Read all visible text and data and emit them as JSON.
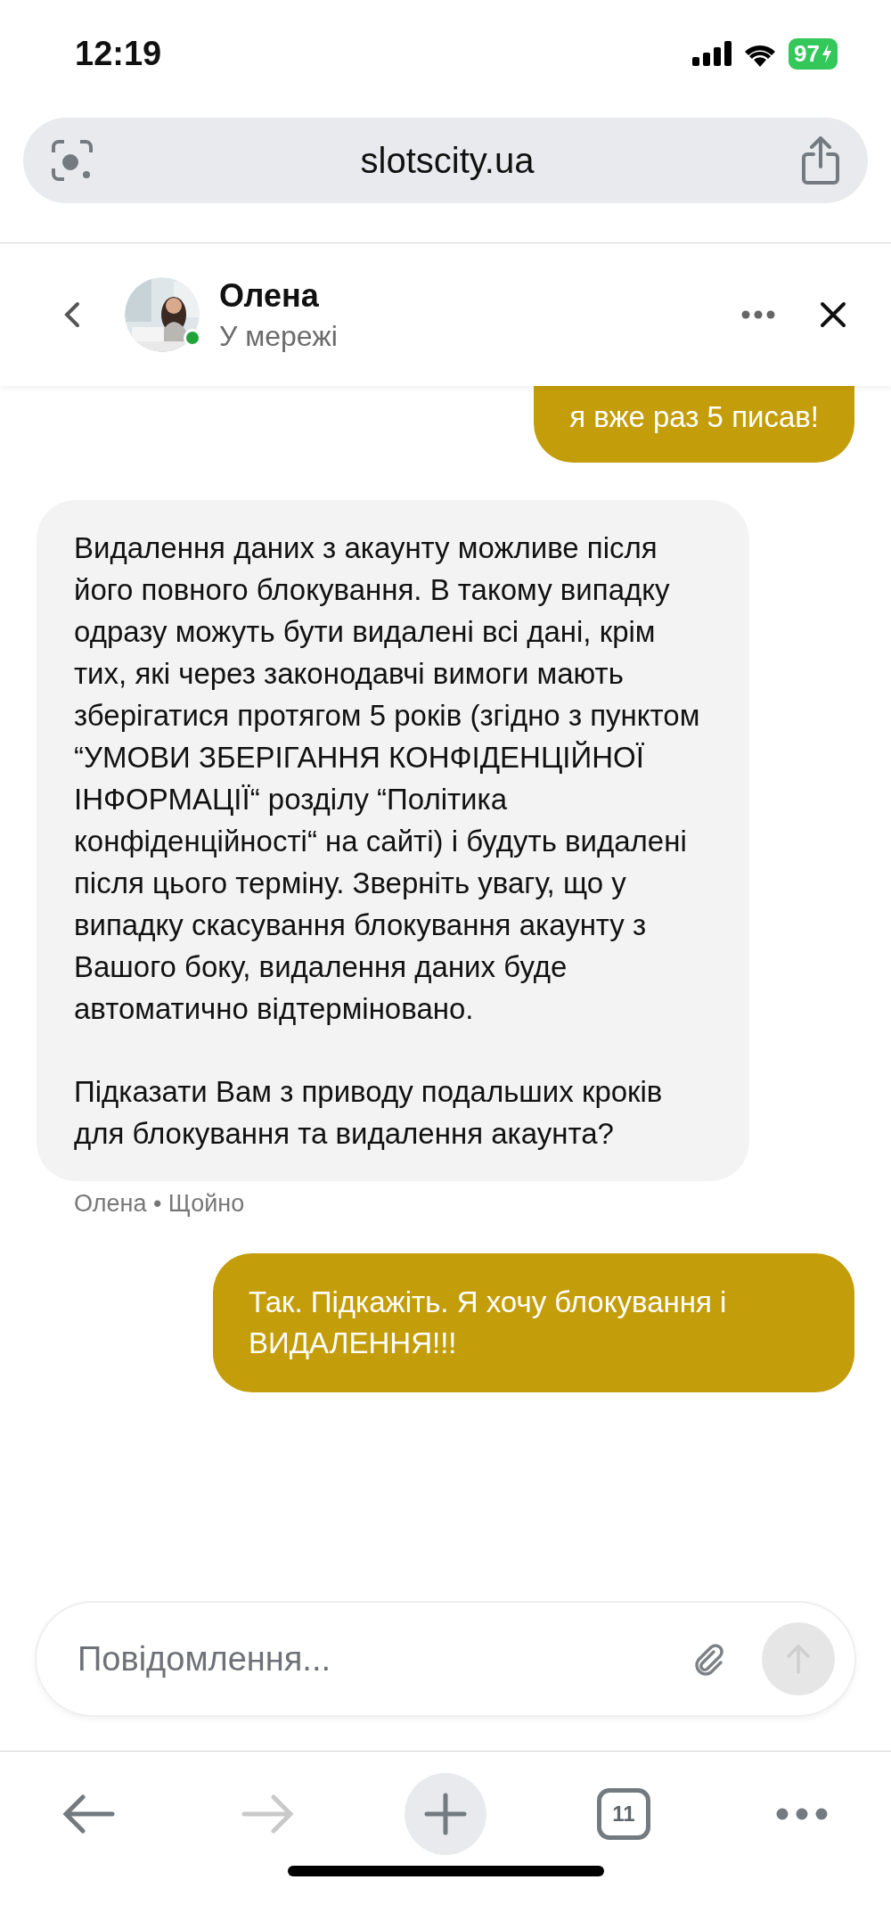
{
  "status_bar": {
    "time": "12:19",
    "battery": "97"
  },
  "browser": {
    "url": "slotscity.ua"
  },
  "chat_header": {
    "name": "Олена",
    "status": "У мережі",
    "online": true
  },
  "messages": [
    {
      "kind": "user",
      "text": "я вже раз 5 писав!"
    },
    {
      "kind": "agent",
      "paragraphs": [
        "Видалення даних з акаунту можливе після його повного блокування. В такому випадку одразу можуть бути видалені всі дані, крім тих, які через законодавчі вимоги мають зберігатися протягом 5 років (згідно з пунктом “УМОВИ ЗБЕРІГАННЯ КОНФІДЕНЦІЙНОЇ ІНФОРМАЦІЇ“ розділу “Політика конфіденційності“ на сайті) і будуть видалені після цього терміну. Зверніть увагу, що у випадку скасування блокування акаунту з Вашого боку, видалення даних буде автоматично відтерміновано.",
        "Підказати Вам з приводу подальших кроків для блокування та видалення акаунта?"
      ],
      "meta": "Олена • Щойно"
    },
    {
      "kind": "user",
      "text": "Так. Підкажіть. Я хочу блокування і ВИДАЛЕННЯ!!!"
    }
  ],
  "composer": {
    "placeholder": "Повідомлення...",
    "send_disabled": true
  },
  "toolbar": {
    "back_disabled": false,
    "forward_disabled": true,
    "tab_count": "11"
  }
}
